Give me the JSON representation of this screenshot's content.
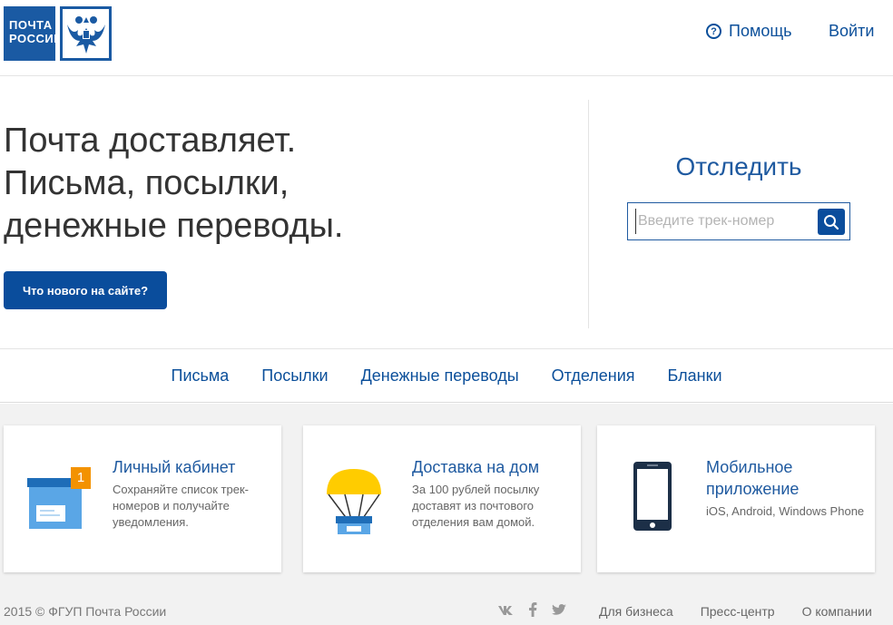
{
  "header": {
    "logo_line1": "ПОЧТА",
    "logo_line2": "РОССИИ",
    "help_label": "Помощь",
    "login_label": "Войти"
  },
  "hero": {
    "line1": "Почта доставляет.",
    "line2": "Письма, посылки,",
    "line3": "денежные переводы.",
    "button_label": "Что нового на сайте?"
  },
  "track": {
    "title": "Отследить",
    "placeholder": "Введите трек-номер",
    "value": ""
  },
  "nav": {
    "items": [
      {
        "label": "Письма"
      },
      {
        "label": "Посылки"
      },
      {
        "label": "Денежные переводы"
      },
      {
        "label": "Отделения"
      },
      {
        "label": "Бланки"
      }
    ]
  },
  "cards": [
    {
      "title": "Личный кабинет",
      "desc": "Сохраняйте список трек-номеров и получайте уведомления.",
      "badge": "1",
      "icon": "box-icon"
    },
    {
      "title": "Доставка на дом",
      "desc": "За 100 рублей посылку доставят из почтового отделения вам домой.",
      "icon": "parachute-box-icon"
    },
    {
      "title": "Мобильное приложение",
      "desc": "iOS, Android, Windows Phone",
      "icon": "smartphone-icon"
    }
  ],
  "footer": {
    "copyright": "2015 © ФГУП Почта России",
    "links": [
      {
        "label": "Для бизнеса"
      },
      {
        "label": "Пресс-центр"
      },
      {
        "label": "О компании"
      }
    ]
  },
  "colors": {
    "brand_blue": "#0a4d9c",
    "link_blue": "#0b4f9a",
    "badge_orange": "#f39200",
    "parachute_yellow": "#ffcc00"
  }
}
